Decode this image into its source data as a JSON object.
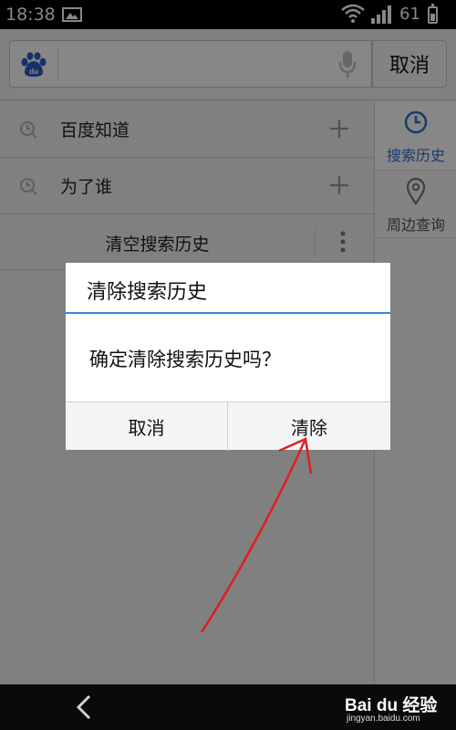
{
  "status_bar": {
    "time": "18:38",
    "battery": "61"
  },
  "search": {
    "placeholder": "",
    "cancel_label": "取消"
  },
  "history": {
    "items": [
      {
        "label": "百度知道"
      },
      {
        "label": "为了谁"
      }
    ],
    "clear_label": "清空搜索历史"
  },
  "side_tabs": [
    {
      "label": "搜索历史",
      "icon": "clock-icon",
      "active": true
    },
    {
      "label": "周边查询",
      "icon": "location-pin-icon",
      "active": false
    }
  ],
  "dialog": {
    "title": "清除搜索历史",
    "message": "确定清除搜索历史吗？",
    "cancel_label": "取消",
    "confirm_label": "清除"
  },
  "watermark": {
    "logo": "Bai du 经验",
    "url": "jingyan.baidu.com"
  },
  "colors": {
    "accent": "#3a86d6",
    "tab_active": "#2f6fd0",
    "arrow": "#e01e1e"
  }
}
